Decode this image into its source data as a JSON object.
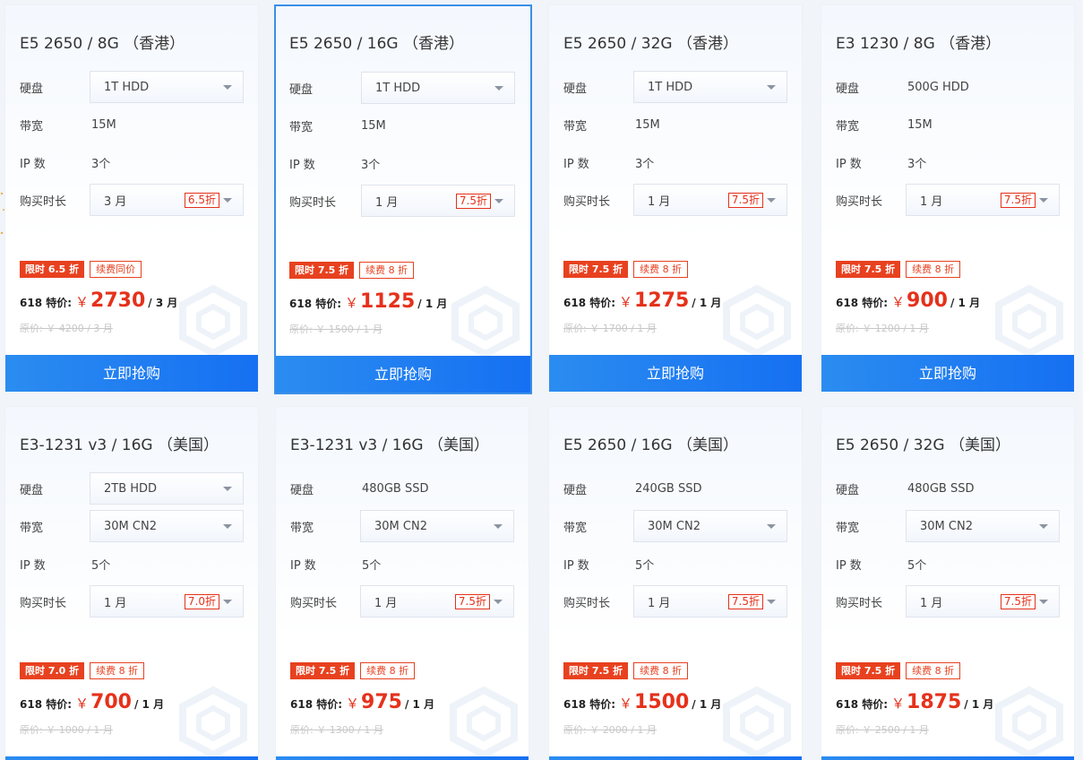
{
  "labels": {
    "disk": "硬盘",
    "bandwidth": "带宽",
    "ip": "IP 数",
    "duration": "购买时长",
    "special": "618 特价:",
    "currency": "￥",
    "buy": "立即抢购"
  },
  "cards": [
    {
      "title": "E5 2650 / 8G （香港）",
      "disk": "1T HDD",
      "disk_select": true,
      "bandwidth": "15M",
      "bandwidth_select": false,
      "ip": "3个",
      "duration": "3 月",
      "duration_discount": "6.5折",
      "tag_limited": "限时 6.5 折",
      "tag_renew": "续费同价",
      "price": "2730",
      "unit": "/ 3 月",
      "original": "原价: ￥ 4200 / 3 月"
    },
    {
      "title": "E5 2650 / 16G （香港）",
      "disk": "1T HDD",
      "disk_select": true,
      "bandwidth": "15M",
      "bandwidth_select": false,
      "ip": "3个",
      "duration": "1 月",
      "duration_discount": "7.5折",
      "tag_limited": "限时 7.5 折",
      "tag_renew": "续费 8 折",
      "price": "1125",
      "unit": "/ 1 月",
      "original": "原价: ￥ 1500 / 1 月",
      "active": true
    },
    {
      "title": "E5 2650 / 32G （香港）",
      "disk": "1T HDD",
      "disk_select": true,
      "bandwidth": "15M",
      "bandwidth_select": false,
      "ip": "3个",
      "duration": "1 月",
      "duration_discount": "7.5折",
      "tag_limited": "限时 7.5 折",
      "tag_renew": "续费 8 折",
      "price": "1275",
      "unit": "/ 1 月",
      "original": "原价: ￥ 1700 / 1 月"
    },
    {
      "title": "E3 1230 / 8G （香港）",
      "disk": "500G HDD",
      "disk_select": false,
      "bandwidth": "15M",
      "bandwidth_select": false,
      "ip": "3个",
      "duration": "1 月",
      "duration_discount": "7.5折",
      "tag_limited": "限时 7.5 折",
      "tag_renew": "续费 8 折",
      "price": "900",
      "unit": "/ 1 月",
      "original": "原价: ￥ 1200 / 1 月"
    },
    {
      "title": "E3-1231 v3 / 16G （美国）",
      "disk": "2TB HDD",
      "disk_select": true,
      "bandwidth": "30M CN2",
      "bandwidth_select": true,
      "ip": "5个",
      "duration": "1 月",
      "duration_discount": "7.0折",
      "tag_limited": "限时 7.0 折",
      "tag_renew": "续费 8 折",
      "price": "700",
      "unit": "/ 1 月",
      "original": "原价: ￥ 1000 / 1 月"
    },
    {
      "title": "E3-1231 v3 / 16G （美国）",
      "disk": "480GB SSD",
      "disk_select": false,
      "bandwidth": "30M CN2",
      "bandwidth_select": true,
      "ip": "5个",
      "duration": "1 月",
      "duration_discount": "7.5折",
      "tag_limited": "限时 7.5 折",
      "tag_renew": "续费 8 折",
      "price": "975",
      "unit": "/ 1 月",
      "original": "原价: ￥ 1300 / 1 月"
    },
    {
      "title": "E5 2650 / 16G （美国）",
      "disk": "240GB SSD",
      "disk_select": false,
      "bandwidth": "30M CN2",
      "bandwidth_select": true,
      "ip": "5个",
      "duration": "1 月",
      "duration_discount": "7.5折",
      "tag_limited": "限时 7.5 折",
      "tag_renew": "续费 8 折",
      "price": "1500",
      "unit": "/ 1 月",
      "original": "原价: ￥ 2000 / 1 月"
    },
    {
      "title": "E5 2650 / 32G （美国）",
      "disk": "480GB SSD",
      "disk_select": false,
      "bandwidth": "30M CN2",
      "bandwidth_select": true,
      "ip": "5个",
      "duration": "1 月",
      "duration_discount": "7.5折",
      "tag_limited": "限时 7.5 折",
      "tag_renew": "续费 8 折",
      "price": "1875",
      "unit": "/ 1 月",
      "original": "原价: ￥ 2500 / 1 月"
    }
  ]
}
